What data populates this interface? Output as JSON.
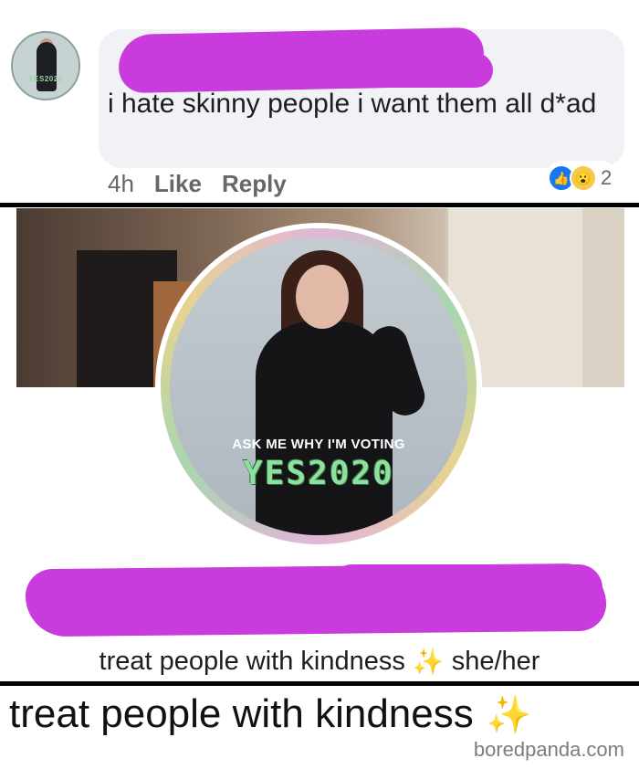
{
  "comment": {
    "avatar_badge": "YES2020",
    "text": "i hate skinny people i want them all d*ad",
    "time": "4h",
    "like_label": "Like",
    "reply_label": "Reply",
    "reaction_count": "2"
  },
  "profile": {
    "badge_line": "ASK ME WHY I'M VOTING",
    "badge_big": "YES2020",
    "bio_text": "treat people with kindness",
    "bio_sparkle": "✨",
    "pronouns": "she/her"
  },
  "caption": {
    "text": "treat people with kindness",
    "sparkle": "✨"
  },
  "watermark": "boredpanda.com",
  "colors": {
    "redaction": "#c93bdc",
    "bubble": "#f0f2f5",
    "link_gray": "#65676b",
    "like_blue": "#1877f2"
  }
}
